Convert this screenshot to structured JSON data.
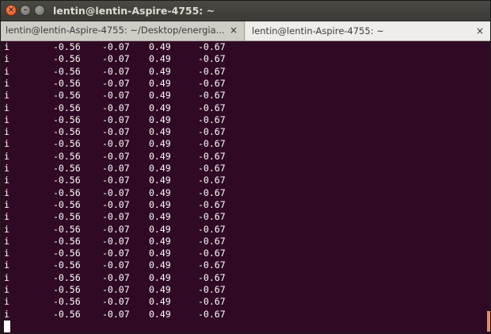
{
  "window": {
    "title": "lentin@lentin-Aspire-4755: ~"
  },
  "tabs": [
    {
      "label": "lentin@lentin-Aspire-4755: ~/Desktop/energia...",
      "close": "×"
    },
    {
      "label": "lentin@lentin-Aspire-4755: ~",
      "close": "×"
    }
  ],
  "terminal": {
    "lines": [
      [
        "i",
        "-0.56",
        "-0.07",
        "0.49",
        "-0.67"
      ],
      [
        "i",
        "-0.56",
        "-0.07",
        "0.49",
        "-0.67"
      ],
      [
        "i",
        "-0.56",
        "-0.07",
        "0.49",
        "-0.67"
      ],
      [
        "i",
        "-0.56",
        "-0.07",
        "0.49",
        "-0.67"
      ],
      [
        "i",
        "-0.56",
        "-0.07",
        "0.49",
        "-0.67"
      ],
      [
        "i",
        "-0.56",
        "-0.07",
        "0.49",
        "-0.67"
      ],
      [
        "i",
        "-0.56",
        "-0.07",
        "0.49",
        "-0.67"
      ],
      [
        "i",
        "-0.56",
        "-0.07",
        "0.49",
        "-0.67"
      ],
      [
        "i",
        "-0.56",
        "-0.07",
        "0.49",
        "-0.67"
      ],
      [
        "i",
        "-0.56",
        "-0.07",
        "0.49",
        "-0.67"
      ],
      [
        "i",
        "-0.56",
        "-0.07",
        "0.49",
        "-0.67"
      ],
      [
        "i",
        "-0.56",
        "-0.07",
        "0.49",
        "-0.67"
      ],
      [
        "i",
        "-0.56",
        "-0.07",
        "0.49",
        "-0.67"
      ],
      [
        "i",
        "-0.56",
        "-0.07",
        "0.49",
        "-0.67"
      ],
      [
        "i",
        "-0.56",
        "-0.07",
        "0.49",
        "-0.67"
      ],
      [
        "i",
        "-0.56",
        "-0.07",
        "0.49",
        "-0.67"
      ],
      [
        "i",
        "-0.56",
        "-0.07",
        "0.49",
        "-0.67"
      ],
      [
        "i",
        "-0.56",
        "-0.07",
        "0.49",
        "-0.67"
      ],
      [
        "i",
        "-0.56",
        "-0.07",
        "0.49",
        "-0.67"
      ],
      [
        "i",
        "-0.56",
        "-0.07",
        "0.49",
        "-0.67"
      ],
      [
        "i",
        "-0.56",
        "-0.07",
        "0.49",
        "-0.67"
      ],
      [
        "i",
        "-0.56",
        "-0.07",
        "0.49",
        "-0.67"
      ],
      [
        "i",
        "-0.56",
        "-0.07",
        "0.49",
        "-0.67"
      ]
    ]
  },
  "colors": {
    "terminal_background": "#300a24",
    "terminal_text": "#ffffff",
    "titlebar": "#3c3b37",
    "close_button": "#df4a16",
    "scrollbar_thumb": "#f08a5d"
  }
}
